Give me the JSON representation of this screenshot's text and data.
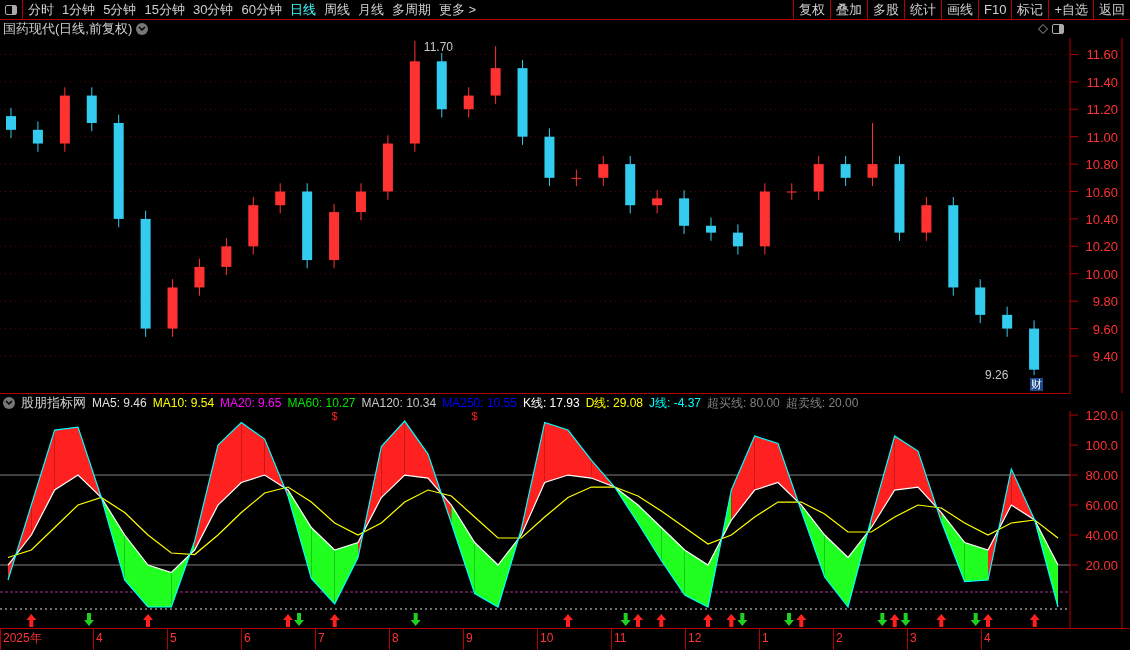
{
  "toolbar": {
    "periods": [
      {
        "label": "分时",
        "selected": false
      },
      {
        "label": "1分钟",
        "selected": false
      },
      {
        "label": "5分钟",
        "selected": false
      },
      {
        "label": "15分钟",
        "selected": false
      },
      {
        "label": "30分钟",
        "selected": false
      },
      {
        "label": "60分钟",
        "selected": false
      },
      {
        "label": "日线",
        "selected": true
      },
      {
        "label": "周线",
        "selected": false
      },
      {
        "label": "月线",
        "selected": false
      },
      {
        "label": "多周期",
        "selected": false
      },
      {
        "label": "更多 >",
        "selected": false
      }
    ],
    "buttons": [
      "复权",
      "叠加",
      "多股",
      "统计",
      "画线",
      "F10",
      "标记",
      "+自选",
      "返回"
    ]
  },
  "main_chart": {
    "title": "国药现代(日线,前复权)",
    "high_label": "11.70",
    "low_label": "9.26",
    "badge": "财",
    "chart_data": {
      "type": "candlestick",
      "grid": true,
      "ylim": [
        9.13,
        11.72
      ],
      "yticks": [
        {
          "value": 11.6,
          "label": "11.60"
        },
        {
          "value": 11.4,
          "label": "11.40"
        },
        {
          "value": 11.2,
          "label": "11.20"
        },
        {
          "value": 11.0,
          "label": "11.00"
        },
        {
          "value": 10.8,
          "label": "10.80"
        },
        {
          "value": 10.6,
          "label": "10.60"
        },
        {
          "value": 10.4,
          "label": "10.40"
        },
        {
          "value": 10.2,
          "label": "10.20"
        },
        {
          "value": 10.0,
          "label": "10.00"
        },
        {
          "value": 9.8,
          "label": "9.80"
        },
        {
          "value": 9.6,
          "label": "9.60"
        },
        {
          "value": 9.4,
          "label": "9.40"
        }
      ],
      "ohlc": [
        [
          11.15,
          11.21,
          10.99,
          11.05
        ],
        [
          11.05,
          11.11,
          10.89,
          10.95
        ],
        [
          10.95,
          11.36,
          10.89,
          11.3
        ],
        [
          11.3,
          11.36,
          11.04,
          11.1
        ],
        [
          11.1,
          11.16,
          10.34,
          10.4
        ],
        [
          10.4,
          10.46,
          9.54,
          9.6
        ],
        [
          9.6,
          9.96,
          9.54,
          9.9
        ],
        [
          9.9,
          10.11,
          9.84,
          10.05
        ],
        [
          10.05,
          10.26,
          9.99,
          10.2
        ],
        [
          10.2,
          10.56,
          10.14,
          10.5
        ],
        [
          10.5,
          10.66,
          10.44,
          10.6
        ],
        [
          10.6,
          10.66,
          10.04,
          10.1
        ],
        [
          10.1,
          10.51,
          10.04,
          10.45
        ],
        [
          10.45,
          10.66,
          10.39,
          10.6
        ],
        [
          10.6,
          11.01,
          10.54,
          10.95
        ],
        [
          10.95,
          11.7,
          10.89,
          11.55
        ],
        [
          11.55,
          11.61,
          11.14,
          11.2
        ],
        [
          11.2,
          11.36,
          11.14,
          11.3
        ],
        [
          11.3,
          11.66,
          11.24,
          11.5
        ],
        [
          11.5,
          11.56,
          10.94,
          11.0
        ],
        [
          11.0,
          11.06,
          10.64,
          10.7
        ],
        [
          10.7,
          10.76,
          10.64,
          10.7
        ],
        [
          10.7,
          10.86,
          10.64,
          10.8
        ],
        [
          10.8,
          10.86,
          10.44,
          10.5
        ],
        [
          10.5,
          10.61,
          10.44,
          10.55
        ],
        [
          10.55,
          10.61,
          10.29,
          10.35
        ],
        [
          10.35,
          10.41,
          10.24,
          10.3
        ],
        [
          10.3,
          10.36,
          10.14,
          10.2
        ],
        [
          10.2,
          10.66,
          10.14,
          10.6
        ],
        [
          10.6,
          10.66,
          10.54,
          10.6
        ],
        [
          10.6,
          10.86,
          10.54,
          10.8
        ],
        [
          10.8,
          10.86,
          10.64,
          10.7
        ],
        [
          10.7,
          11.1,
          10.64,
          10.8
        ],
        [
          10.8,
          10.86,
          10.24,
          10.3
        ],
        [
          10.3,
          10.56,
          10.24,
          10.5
        ],
        [
          10.5,
          10.56,
          9.84,
          9.9
        ],
        [
          9.9,
          9.96,
          9.64,
          9.7
        ],
        [
          9.7,
          9.76,
          9.54,
          9.6
        ],
        [
          9.6,
          9.66,
          9.26,
          9.3
        ]
      ]
    }
  },
  "indicator": {
    "name": "股朋指标网",
    "legend": [
      {
        "text": "MA5: 9.46",
        "color": "#e0e0e0"
      },
      {
        "text": "MA10: 9.54",
        "color": "#ffff00"
      },
      {
        "text": "MA20: 9.65",
        "color": "#ff00ff"
      },
      {
        "text": "MA60: 10.27",
        "color": "#00e600"
      },
      {
        "text": "MA120: 10.34",
        "color": "#c8c8c8"
      },
      {
        "text": "MA250: 10.55",
        "color": "#0000ff"
      },
      {
        "text": "K线: 17.93",
        "color": "#ffffff"
      },
      {
        "text": "D线: 29.08",
        "color": "#ffff00"
      },
      {
        "text": "J线: -4.37",
        "color": "#00ffff"
      },
      {
        "text": "超买线: 80.00",
        "color": "#808080"
      },
      {
        "text": "超卖线: 20.00",
        "color": "#808080"
      }
    ],
    "markers": [
      {
        "label": "$"
      },
      {
        "label": "$"
      }
    ],
    "chart_data": {
      "type": "line",
      "ylim": [
        -22,
        122.7
      ],
      "yticks": [
        {
          "value": 120,
          "label": "120.0"
        },
        {
          "value": 100,
          "label": "100.0"
        },
        {
          "value": 80,
          "label": "80.00"
        },
        {
          "value": 60,
          "label": "60.00"
        },
        {
          "value": 40,
          "label": "40.00"
        },
        {
          "value": 20,
          "label": "20.00"
        }
      ],
      "series": [
        {
          "color": "#ffffff",
          "values": [
            20,
            40,
            70,
            80,
            65,
            40,
            20,
            15,
            30,
            60,
            75,
            80,
            70,
            45,
            30,
            35,
            65,
            80,
            78,
            60,
            35,
            20,
            40,
            75,
            80,
            78,
            72,
            60,
            45,
            30,
            20,
            50,
            70,
            75,
            60,
            40,
            25,
            45,
            70,
            72,
            55,
            35,
            30,
            60,
            50,
            20
          ]
        },
        {
          "color": "#ffff00",
          "values": [
            25,
            30,
            45,
            60,
            65,
            55,
            40,
            28,
            27,
            40,
            55,
            68,
            72,
            62,
            48,
            40,
            48,
            62,
            70,
            66,
            52,
            38,
            38,
            52,
            65,
            72,
            72,
            66,
            56,
            45,
            34,
            40,
            52,
            62,
            62,
            54,
            42,
            42,
            52,
            60,
            58,
            48,
            40,
            48,
            50,
            38
          ]
        },
        {
          "color": "#00ffff",
          "values": [
            10,
            60,
            110,
            112,
            65,
            10,
            -8,
            -8,
            36,
            100,
            115,
            104,
            66,
            11,
            -6,
            25,
            99,
            116,
            94,
            48,
            1,
            -8,
            44,
            115,
            110,
            90,
            72,
            48,
            23,
            0,
            -8,
            70,
            106,
            101,
            56,
            12,
            -8,
            51,
            106,
            96,
            49,
            9,
            10,
            84,
            50,
            -8
          ]
        }
      ]
    }
  },
  "date_axis": [
    "2025年",
    "4",
    "5",
    "6",
    "7",
    "8",
    "9",
    "10",
    "11",
    "12",
    "1",
    "2",
    "3",
    "4"
  ]
}
